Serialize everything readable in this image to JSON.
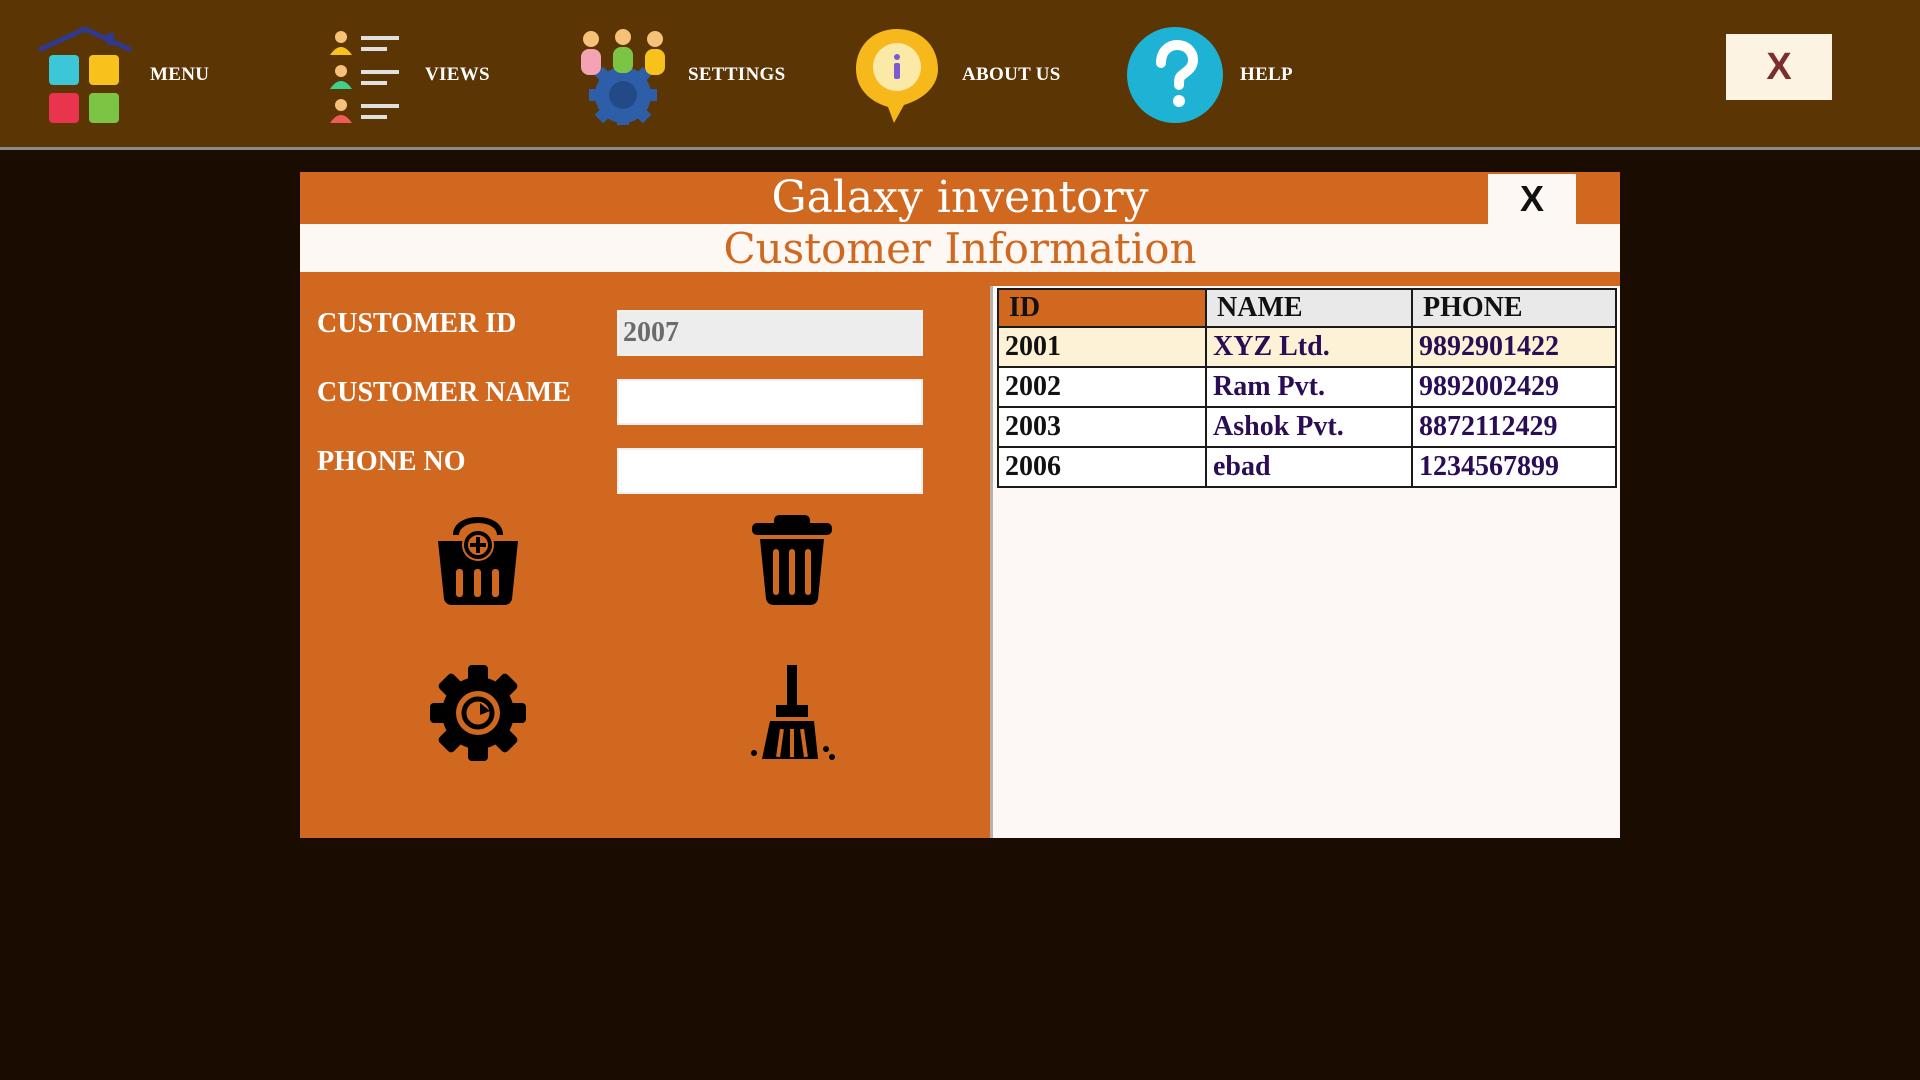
{
  "nav": {
    "menu": "MENU",
    "views": "VIEWS",
    "settings": "SETTINGS",
    "about": "ABOUT US",
    "help": "HELP",
    "close": "X"
  },
  "dialog": {
    "title": "Galaxy inventory",
    "close": "X",
    "subtitle": "Customer Information"
  },
  "form": {
    "id_label": "CUSTOMER ID",
    "id_value": "2007",
    "name_label": "CUSTOMER NAME",
    "name_value": "",
    "phone_label": "PHONE NO",
    "phone_value": ""
  },
  "actions": {
    "add": "add-basket-icon",
    "delete": "trash-icon",
    "update": "gear-icon",
    "clear": "broom-icon"
  },
  "table": {
    "headers": [
      "ID",
      "NAME",
      "PHONE"
    ],
    "rows": [
      {
        "id": "2001",
        "name": "XYZ Ltd.",
        "phone": "9892901422"
      },
      {
        "id": "2002",
        "name": "Ram Pvt.",
        "phone": "9892002429"
      },
      {
        "id": "2003",
        "name": "Ashok Pvt.",
        "phone": "8872112429"
      },
      {
        "id": "2006",
        "name": "ebad",
        "phone": "1234567899"
      }
    ]
  },
  "colors": {
    "topbar": "#5c3505",
    "background": "#1b0c02",
    "accent": "#d06820",
    "panel": "#fdf8f3"
  }
}
